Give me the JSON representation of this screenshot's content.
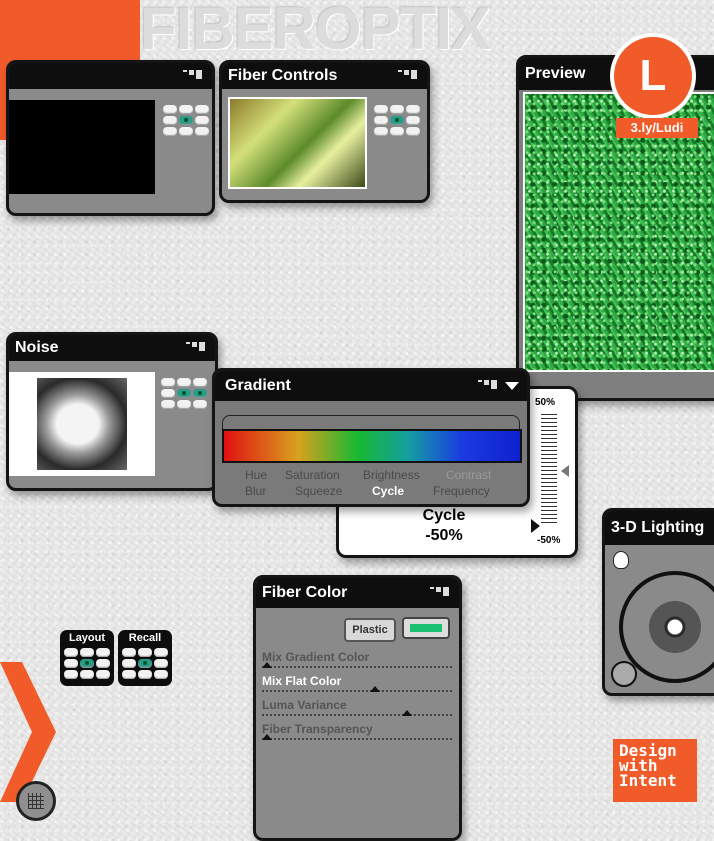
{
  "brand": {
    "logo_text": "FIBEROPTIX"
  },
  "badges": {
    "circle_letter": "L",
    "url": "3.ly/Ludi",
    "footer_lines": [
      "Design",
      "with",
      "Intent"
    ]
  },
  "panels": {
    "fiber_controls": {
      "title": "Fiber Controls"
    },
    "preview": {
      "title": "Preview"
    },
    "noise": {
      "title": "Noise"
    },
    "gradient": {
      "title": "Gradient",
      "tabs_row1": [
        "Hue",
        "Saturation",
        "Brightness",
        "Contrast"
      ],
      "tabs_row2": [
        "Blur",
        "Squeeze",
        "Cycle",
        "Frequency"
      ],
      "active_tab": "Cycle"
    },
    "cycle_readout": {
      "label": "Cycle",
      "value": "-50%",
      "scale_top": "50%",
      "scale_bottom": "-50%"
    },
    "lighting": {
      "title": "3-D Lighting"
    },
    "fiber_color": {
      "title": "Fiber Color",
      "plastic_label": "Plastic",
      "swatch_color": "#19c070",
      "sliders": [
        {
          "label": "Mix Gradient Color",
          "value": 0.0
        },
        {
          "label": "Mix Flat Color",
          "value": 0.6
        },
        {
          "label": "Luma Variance",
          "value": 0.78
        },
        {
          "label": "Fiber Transparency",
          "value": 0.0
        }
      ]
    }
  },
  "pads": {
    "layout_label": "Layout",
    "recall_label": "Recall"
  },
  "colors": {
    "accent_orange": "#f15a29",
    "panel_gray": "#8a8a8a",
    "panel_black": "#0e0e0e",
    "active_button": "#2a9a8a"
  }
}
